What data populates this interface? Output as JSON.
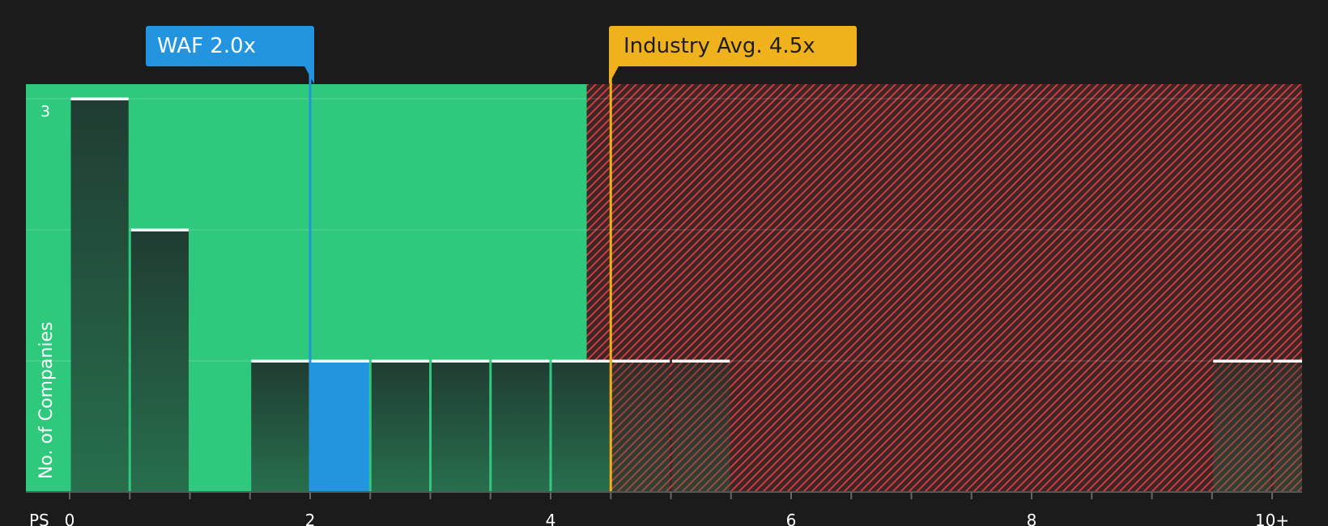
{
  "colors": {
    "background": "#1b1b1b",
    "fair_zone": "#2ec97d",
    "overvalued_zone": "#3a2626",
    "hatch": "#d23c3c",
    "bar_fill_top": "#203c32",
    "bar_fill_bottom": "#276f4d",
    "company": "#2394e0",
    "industry": "#f0b21c",
    "bar_cap": "#ffffff",
    "axis_text": "#ffffff"
  },
  "callouts": {
    "company": "WAF 2.0x",
    "industry": "Industry Avg. 4.5x"
  },
  "chart_data": {
    "type": "bar",
    "xlabel": "PS",
    "ylabel": "No. of Companies",
    "xlim": [
      0,
      10.3
    ],
    "ylim": [
      0,
      3
    ],
    "x_ticks": [
      0,
      2,
      4,
      6,
      8,
      10
    ],
    "x_tick_labels": [
      "0",
      "2",
      "4",
      "6",
      "8",
      "10+"
    ],
    "y_tick_labels": [
      {
        "value": 3,
        "label": "3"
      }
    ],
    "bin_width": 0.5,
    "bins": [
      {
        "start": 0.0,
        "count": 3
      },
      {
        "start": 0.5,
        "count": 2
      },
      {
        "start": 1.5,
        "count": 1
      },
      {
        "start": 2.0,
        "count": 1
      },
      {
        "start": 2.5,
        "count": 1
      },
      {
        "start": 3.0,
        "count": 1
      },
      {
        "start": 3.5,
        "count": 1
      },
      {
        "start": 4.0,
        "count": 1
      },
      {
        "start": 4.5,
        "count": 1
      },
      {
        "start": 5.0,
        "count": 1
      },
      {
        "start": 9.5,
        "count": 1
      },
      {
        "start": 10.0,
        "count": 1
      }
    ],
    "company": {
      "name": "WAF",
      "value": 2.0
    },
    "industry_average": 4.5,
    "fair_value_threshold": 4.3
  }
}
